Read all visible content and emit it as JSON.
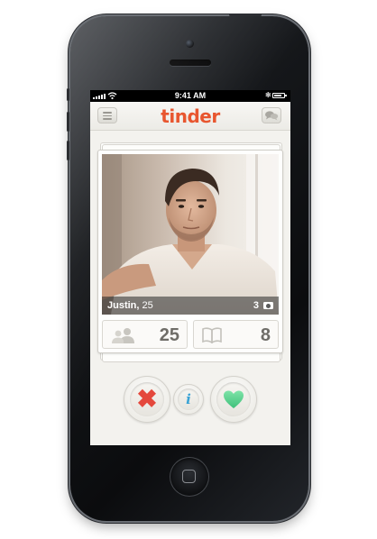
{
  "status_bar": {
    "time": "9:41 AM"
  },
  "nav": {
    "logo": "tinder"
  },
  "card": {
    "name": "Justin",
    "age": "25",
    "photo_count": "3",
    "friends_count": "25",
    "interests_count": "8"
  },
  "icons": {
    "menu": "menu-icon",
    "chat": "chat-bubbles-icon",
    "camera": "camera-icon",
    "friends": "people-icon",
    "interests": "book-icon",
    "nope": "x-icon",
    "info": "info-icon",
    "like": "heart-icon"
  },
  "colors": {
    "brand": "#e8562f",
    "nope": "#e4483c",
    "like": "#4fcf8a",
    "info": "#3aa3d5",
    "screen_bg": "#f3f2ee"
  }
}
